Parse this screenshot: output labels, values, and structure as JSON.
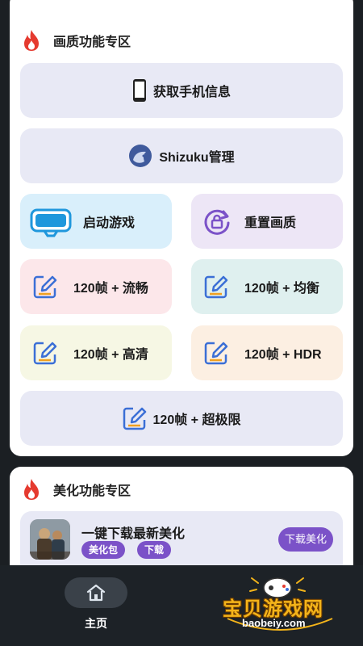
{
  "quality_section": {
    "title": "画质功能专区",
    "get_phone_info": "获取手机信息",
    "shizuku_manage": "Shizuku管理",
    "start_game": "启动游戏",
    "reset_quality": "重置画质",
    "fps_smooth": "120帧 + 流畅",
    "fps_balanced": "120帧 + 均衡",
    "fps_hd": "120帧 + 高清",
    "fps_hdr": "120帧 + HDR",
    "fps_extreme": "120帧 + 超极限"
  },
  "beauty_section": {
    "title": "美化功能专区",
    "item_title": "一键下载最新美化",
    "tags": [
      "美化包",
      "下载"
    ],
    "download_button": "下载美化"
  },
  "bottom_nav": {
    "home_label": "主页"
  },
  "watermark": {
    "text": "宝贝游戏网",
    "url": "baobeiy.com"
  },
  "colors": {
    "accent_purple": "#7b52c8",
    "fire_red": "#e53a2f",
    "edit_icon_blue": "#3b6fd6",
    "edit_icon_orange": "#f0a020"
  },
  "icons": {
    "section": "fire-icon",
    "phone": "smartphone-icon",
    "shizuku": "shizuku-icon",
    "game": "vr-headset-icon",
    "reset": "lock-rotate-icon",
    "fps": "edit-icon",
    "home": "home-icon"
  }
}
